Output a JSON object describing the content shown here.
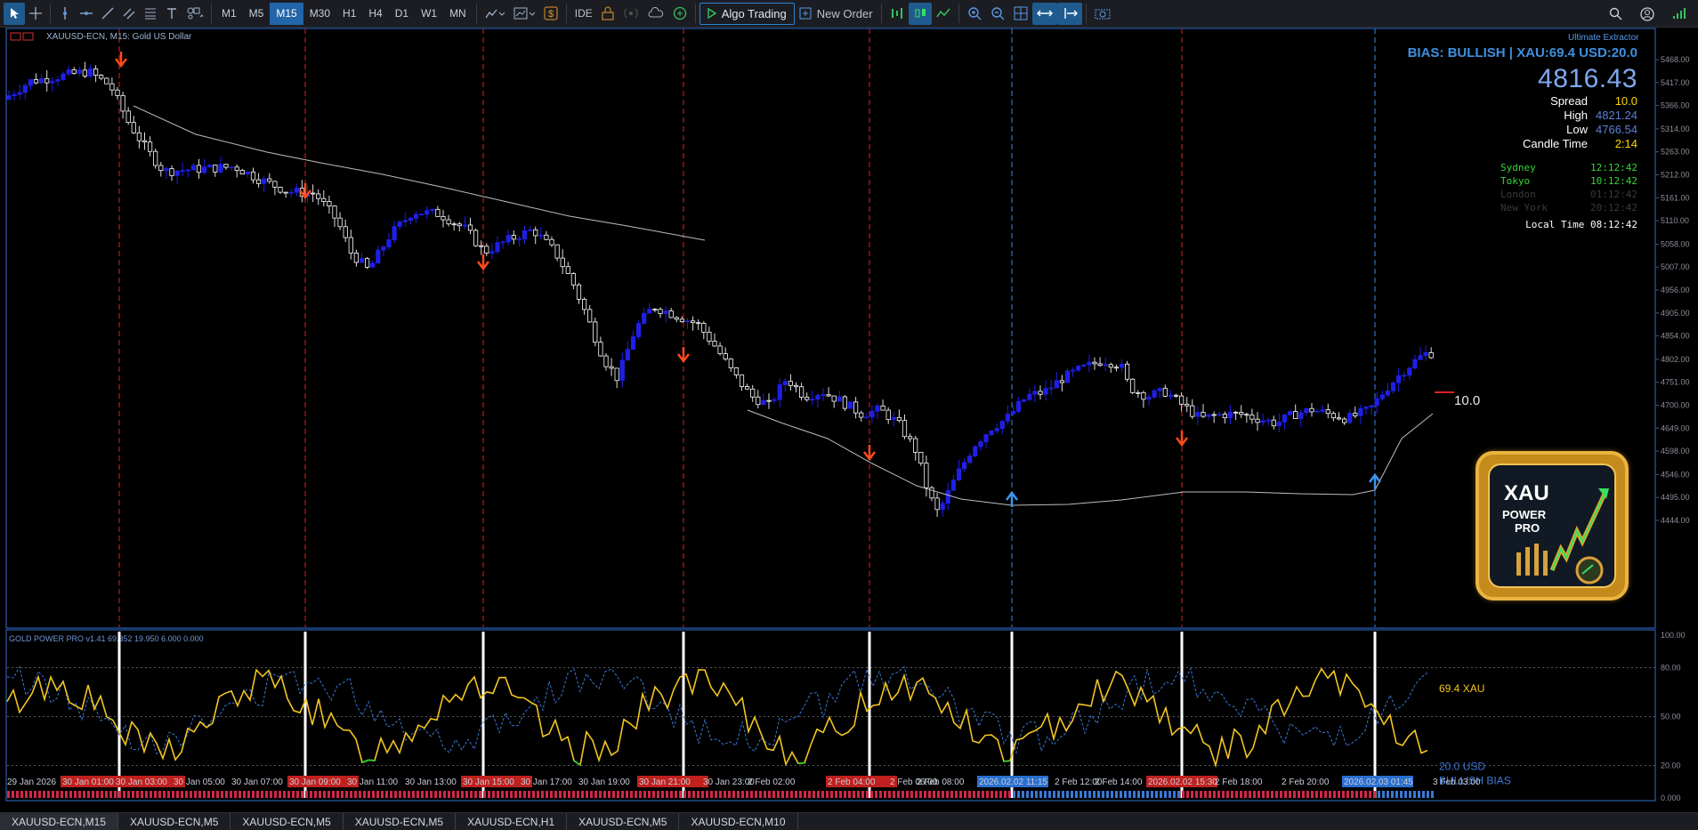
{
  "toolbar": {
    "timeframes": [
      "M1",
      "M5",
      "M15",
      "M30",
      "H1",
      "H4",
      "D1",
      "W1",
      "MN"
    ],
    "active_timeframe": "M15",
    "ide_label": "IDE",
    "algo_label": "Algo Trading",
    "new_order_label": "New Order"
  },
  "chart": {
    "symbol_label": "XAUUSD-ECN, M15:  Gold US Dollar",
    "indicator_label": "Ultimate Extractor",
    "price_labels": [
      "5468.00",
      "5417.00",
      "5366.00",
      "5314.00",
      "5263.00",
      "5212.00",
      "5161.00",
      "5110.00",
      "5058.00",
      "5007.00",
      "4956.00",
      "4905.00",
      "4854.00",
      "4802.00",
      "4751.00",
      "4700.00",
      "4649.00",
      "4598.00",
      "4546.00",
      "4495.00",
      "4444.00"
    ],
    "last_label": "10.0",
    "colors": {
      "bull": "#1f1fe8",
      "bear_border": "#ffffff",
      "sell_arrow": "#ff4a1a",
      "buy_arrow": "#3e94f0",
      "sell_line": "#e0201e",
      "buy_line": "#3a8ee6",
      "ma": "#bdbdbd"
    }
  },
  "panel": {
    "bias": "BIAS: BULLISH | XAU:69.4 USD:20.0",
    "price": "4816.43",
    "stats": [
      {
        "label": "Spread",
        "value": "10.0",
        "color": "#ffd400"
      },
      {
        "label": "High",
        "value": "4821.24",
        "color": "#5b7fd6"
      },
      {
        "label": "Low",
        "value": "4766.54",
        "color": "#5b7fd6"
      },
      {
        "label": "Candle Time",
        "value": "2:14",
        "color": "#ffd400"
      }
    ],
    "sessions": [
      {
        "label": "Sydney",
        "time": "12:12:42",
        "color": "#36d636"
      },
      {
        "label": "Tokyo",
        "time": "10:12:42",
        "color": "#36d636"
      },
      {
        "label": "London",
        "time": "01:12:42",
        "color": "#3a3a3a"
      },
      {
        "label": "New York",
        "time": "20:12:42",
        "color": "#3a3a3a"
      }
    ],
    "local_time": "Local Time 08:12:42"
  },
  "logo": {
    "line1": "XAU",
    "line2": "POWER",
    "line3": "PRO"
  },
  "oscillator": {
    "title": "GOLD POWER PRO v1.41 69.352 19.950 6.000 0.000",
    "levels": [
      "100.00",
      "80.00",
      "50.00",
      "20.00",
      "0.000"
    ],
    "xau_label": "69.4 XAU",
    "usd_label": "20.0 USD",
    "bias_label": "BULLISH BIAS"
  },
  "time_axis": [
    "29 Jan 2026",
    "30 Jan 01:00",
    "30 Jan 03:00",
    "30 Jan 05:00",
    "30 Jan 07:00",
    "30 Jan 09:00",
    "30 Jan 11:00",
    "30 Jan 13:00",
    "30 Jan 15:00",
    "30 Jan 17:00",
    "30 Jan 19:00",
    "30 Jan 21:00",
    "30 Jan 23:00",
    "2 Feb 02:00",
    "2 Feb 04:00",
    "2 Feb 06:00",
    "2 Feb 08:00",
    "2026.02.02 11:15",
    "2 Feb 12:00",
    "2 Feb 14:00",
    "2026.02.02 15:30",
    "2 Feb 18:00",
    "2 Feb 20:00",
    "2026.02.03 01:45",
    "3 Feb 03:00"
  ],
  "tabs": [
    "XAUUSD-ECN,M15",
    "XAUUSD-ECN,M5",
    "XAUUSD-ECN,M5",
    "XAUUSD-ECN,M5",
    "XAUUSD-ECN,H1",
    "XAUUSD-ECN,M5",
    "XAUUSD-ECN,M10"
  ]
}
